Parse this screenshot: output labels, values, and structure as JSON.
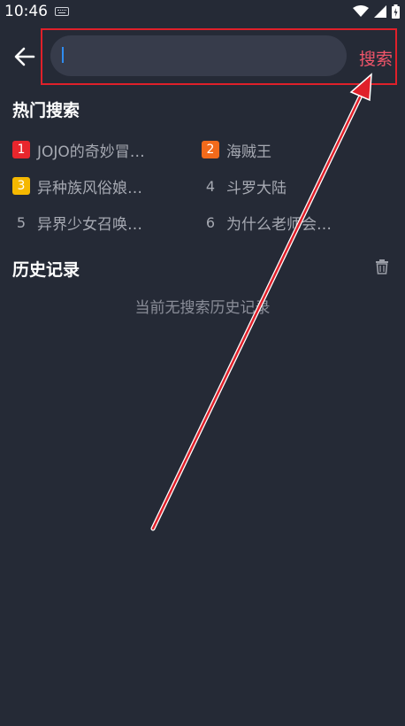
{
  "status_bar": {
    "time": "10:46"
  },
  "header": {
    "search_placeholder": "",
    "search_value": "",
    "search_button_label": "搜索"
  },
  "hot_search": {
    "title": "热门搜索",
    "items": [
      {
        "rank": "1",
        "text": "JOJO的奇妙冒…",
        "badge_color": "#e8262d"
      },
      {
        "rank": "2",
        "text": "海贼王",
        "badge_color": "#f26a1b"
      },
      {
        "rank": "3",
        "text": "异种族风俗娘…",
        "badge_color": "#f5b800"
      },
      {
        "rank": "4",
        "text": "斗罗大陆",
        "badge_color": ""
      },
      {
        "rank": "5",
        "text": "异界少女召唤…",
        "badge_color": ""
      },
      {
        "rank": "6",
        "text": "为什么老师会…",
        "badge_color": ""
      }
    ]
  },
  "history": {
    "title": "历史记录",
    "empty_text": "当前无搜索历史记录"
  },
  "colors": {
    "background": "#252a36",
    "accent": "#f0556a",
    "highlight": "#e0202a"
  }
}
